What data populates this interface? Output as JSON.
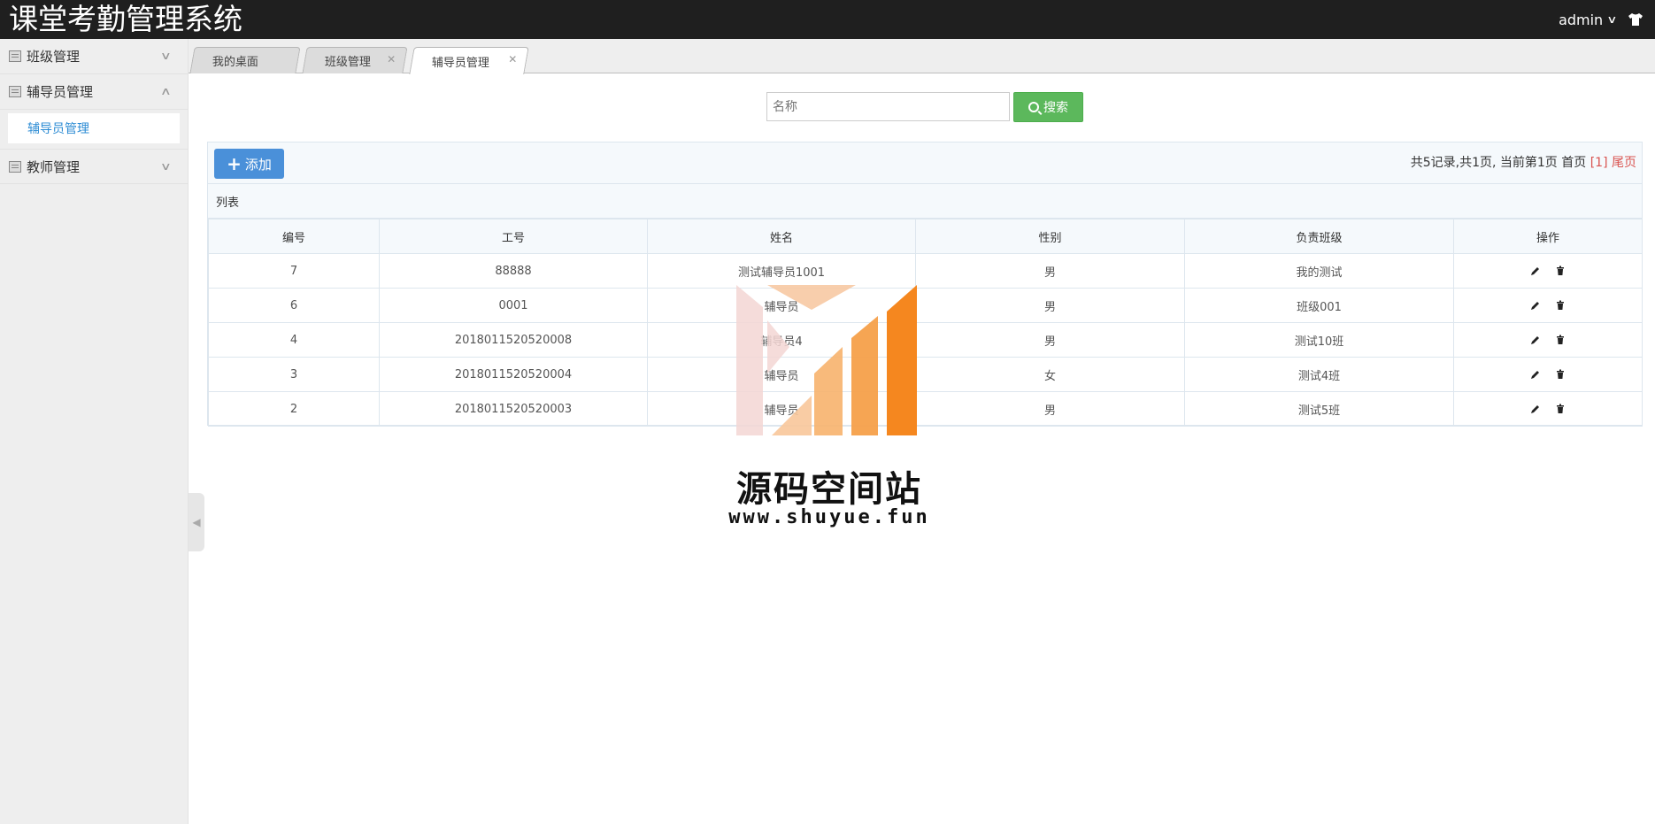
{
  "header": {
    "title": "课堂考勤管理系统",
    "user": "admin",
    "shirt_icon": "shirt-icon"
  },
  "sidebar": {
    "groups": [
      {
        "label": "班级管理",
        "expanded": false
      },
      {
        "label": "辅导员管理",
        "expanded": true,
        "items": [
          {
            "label": "辅导员管理",
            "active": true
          }
        ]
      },
      {
        "label": "教师管理",
        "expanded": false
      }
    ]
  },
  "tabs": [
    {
      "label": "我的桌面",
      "closable": false
    },
    {
      "label": "班级管理",
      "closable": true
    },
    {
      "label": "辅导员管理",
      "closable": true,
      "active": true
    }
  ],
  "search": {
    "placeholder": "名称",
    "value": "",
    "button": "搜索"
  },
  "toolbar": {
    "add_label": "添加"
  },
  "pager": {
    "summary": "共5记录,共1页, 当前第1页 首页",
    "current": "[1]",
    "last": "尾页"
  },
  "list": {
    "title": "列表",
    "columns": [
      "编号",
      "工号",
      "姓名",
      "性别",
      "负责班级",
      "操作"
    ],
    "rows": [
      [
        "7",
        "88888",
        "测试辅导员1001",
        "男",
        "我的测试"
      ],
      [
        "6",
        "0001",
        "辅导员",
        "男",
        "班级001"
      ],
      [
        "4",
        "2018011520520008",
        "辅导员4",
        "男",
        "测试10班"
      ],
      [
        "3",
        "2018011520520004",
        "辅导员",
        "女",
        "测试4班"
      ],
      [
        "2",
        "2018011520520003",
        "辅导员",
        "男",
        "测试5班"
      ]
    ]
  },
  "watermark": {
    "title": "源码空间站",
    "url": "www.shuyue.fun"
  },
  "colors": {
    "header_bg": "#1f1f1f",
    "search_green": "#5cb85c",
    "add_blue": "#4a90d9",
    "link_blue": "#2d8cd4",
    "pager_red": "#d9534f",
    "watermark_orange": "#f5871f"
  }
}
